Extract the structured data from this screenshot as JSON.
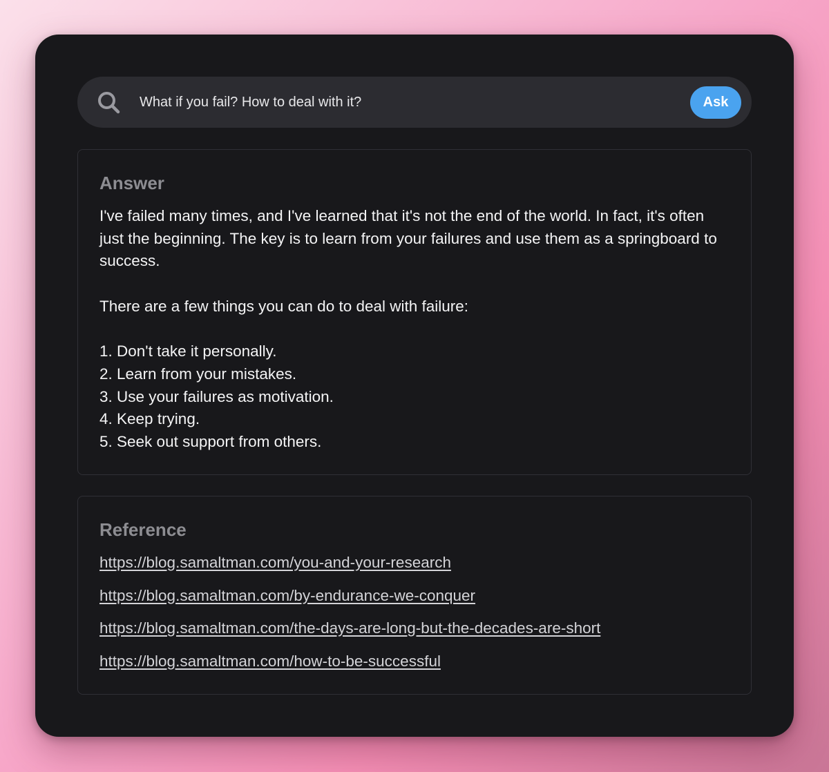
{
  "search": {
    "icon": "search-icon",
    "value": "What if you fail? How to deal with it?",
    "button_label": "Ask",
    "button_color": "#4aa3ef"
  },
  "answer": {
    "heading": "Answer",
    "intro": "I've failed many times, and I've learned that it's not the end of the world. In fact, it's often just the beginning. The key is to learn from your failures and use them as a springboard to success.",
    "lead": "There are a few things you can do to deal with failure:",
    "items": [
      "1. Don't take it personally.",
      "2. Learn from your mistakes.",
      "3. Use your failures as motivation.",
      "4. Keep trying.",
      "5. Seek out support from others."
    ]
  },
  "reference": {
    "heading": "Reference",
    "links": [
      "https://blog.samaltman.com/you-and-your-research",
      "https://blog.samaltman.com/by-endurance-we-conquer",
      "https://blog.samaltman.com/the-days-are-long-but-the-decades-are-short",
      "https://blog.samaltman.com/how-to-be-successful"
    ]
  }
}
